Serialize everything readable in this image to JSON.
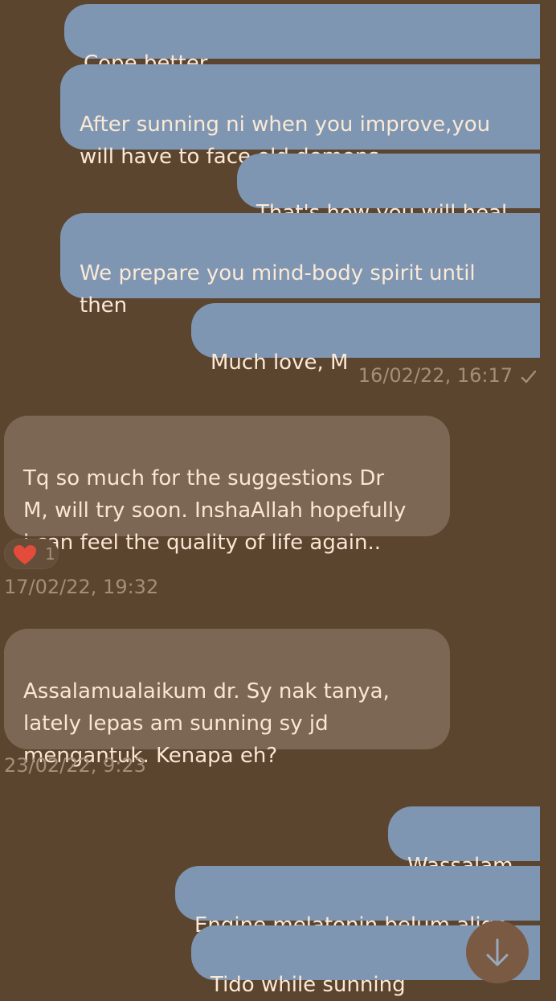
{
  "messages": {
    "m1": "Cope better",
    "m2": "After sunning ni when you improve,you\nwill have to face old demons",
    "m3": "That's how you will heal",
    "m4": "We prepare you mind-body spirit until\nthen",
    "m5": "Much love, M",
    "t1": "16/02/22, 16:17",
    "m6": "Tq so much for the suggestions Dr\nM, will try soon. InshaAllah hopefully\ni can feel the quality of life again..",
    "reaction_count": "1",
    "t2": "17/02/22, 19:32",
    "m7": "Assalamualaikum dr. Sy nak tanya,\nlately lepas am sunning sy jd\nmengantuk. Kenapa eh?",
    "t3": "23/02/22, 9:23",
    "m8": "Wassalam",
    "m9": "Engine melatonin belum align",
    "m10": "Tido while sunning"
  },
  "icons": {
    "read_receipt": "checkmark-icon",
    "reaction": "heart-icon",
    "scroll": "arrow-down-icon"
  },
  "colors": {
    "background": "#5c452f",
    "outgoing_bubble": "#7e96b1",
    "incoming_bubble": "#7c6755",
    "text": "#fbe9d7",
    "heart": "#e34b3a"
  }
}
